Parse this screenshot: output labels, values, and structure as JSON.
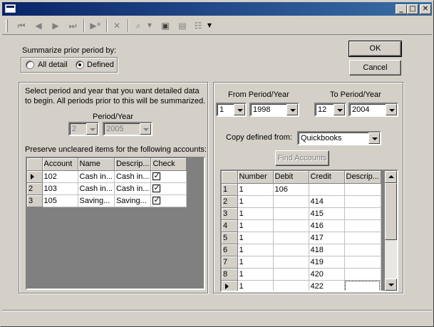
{
  "window": {
    "title": "",
    "icons": {
      "app": "window-icon",
      "minimize": "minimize-icon",
      "maximize": "maximize-icon",
      "close": "close-icon"
    }
  },
  "toolbar": {
    "icons": [
      "first-record-icon",
      "prev-record-icon",
      "next-record-icon",
      "last-record-icon",
      "new-record-icon",
      "delete-icon",
      "find-icon",
      "save-icon",
      "save-close-icon",
      "properties-icon"
    ]
  },
  "summarize": {
    "label": "Summarize prior period by:",
    "options": [
      {
        "label": "All detail",
        "selected": false
      },
      {
        "label": "Defined",
        "selected": true
      }
    ]
  },
  "buttons": {
    "ok": "OK",
    "cancel": "Cancel",
    "find_accounts": "Find Accounts"
  },
  "left_panel": {
    "description_line1": "Select period and year that you want detailed data",
    "description_line2": "to begin. All periods prior to this will be summarized.",
    "period_year_label": "Period/Year",
    "period_value": "2",
    "year_value": "2005",
    "preserve_label": "Preserve uncleared items for the following accounts:",
    "columns": [
      "Account",
      "Name",
      "Descrip...",
      "Check"
    ],
    "rows": [
      {
        "num": "",
        "account": "102",
        "name": "Cash in...",
        "desc": "Cash in...",
        "check": true,
        "current": true
      },
      {
        "num": "2",
        "account": "103",
        "name": "Cash in...",
        "desc": "Cash in...",
        "check": true,
        "current": false
      },
      {
        "num": "3",
        "account": "105",
        "name": "Saving...",
        "desc": "Saving...",
        "check": true,
        "current": false
      }
    ]
  },
  "right_panel": {
    "from_label": "From Period/Year",
    "to_label": "To Period/Year",
    "from_period": "1",
    "from_year": "1998",
    "to_period": "12",
    "to_year": "2004",
    "copy_label": "Copy defined from:",
    "copy_value": "Quickbooks",
    "columns": [
      "Number",
      "Debit",
      "Credit",
      "Descrip..."
    ],
    "rows": [
      {
        "num": "1",
        "number": "1",
        "debit": "106",
        "credit": "",
        "desc": ""
      },
      {
        "num": "2",
        "number": "1",
        "debit": "",
        "credit": "414",
        "desc": ""
      },
      {
        "num": "3",
        "number": "1",
        "debit": "",
        "credit": "415",
        "desc": ""
      },
      {
        "num": "4",
        "number": "1",
        "debit": "",
        "credit": "416",
        "desc": ""
      },
      {
        "num": "5",
        "number": "1",
        "debit": "",
        "credit": "417",
        "desc": ""
      },
      {
        "num": "6",
        "number": "1",
        "debit": "",
        "credit": "418",
        "desc": ""
      },
      {
        "num": "7",
        "number": "1",
        "debit": "",
        "credit": "419",
        "desc": ""
      },
      {
        "num": "8",
        "number": "1",
        "debit": "",
        "credit": "420",
        "desc": ""
      },
      {
        "num": "",
        "number": "1",
        "debit": "",
        "credit": "422",
        "desc": ""
      }
    ]
  }
}
